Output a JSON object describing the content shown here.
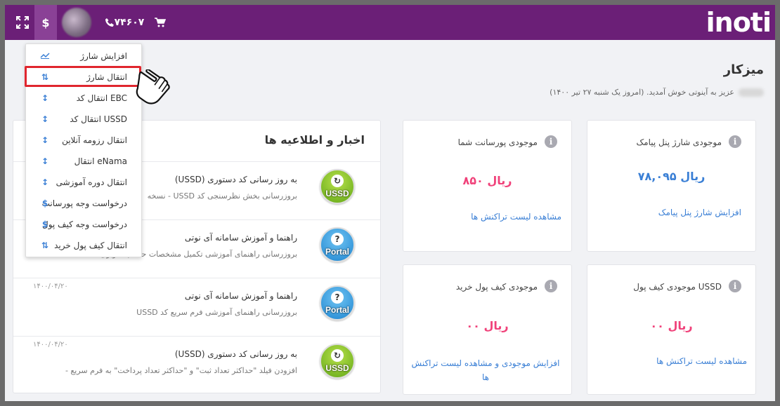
{
  "topbar": {
    "phone": "۷۴۶۰۷",
    "logo": "inoti",
    "expand_icon": "expand-icon",
    "currency_symbol": "$",
    "cart_icon": "cart-icon",
    "colors": {
      "bar": "#6b1f77",
      "active": "#8a4196"
    }
  },
  "page": {
    "title": "میزکار",
    "welcome": "عزیز به آینوتی خوش آمدید. (امروز یک شنبه ۲۷ تیر ۱۴۰۰)"
  },
  "menu": {
    "items": [
      {
        "label": "افزایش شارژ",
        "icon": "chart-line-icon"
      },
      {
        "label": "انتقال شارژ",
        "icon": "transfer-icon"
      },
      {
        "label": "EBC انتقال کد",
        "icon": "transfer-vertical-icon"
      },
      {
        "label": "USSD انتقال کد",
        "icon": "transfer-vertical-icon"
      },
      {
        "label": "انتقال رزومه آنلاین",
        "icon": "transfer-vertical-icon"
      },
      {
        "label": "eNama انتقال",
        "icon": "transfer-vertical-icon"
      },
      {
        "label": "انتقال دوره آموزشی",
        "icon": "transfer-vertical-icon"
      },
      {
        "label": "درخواست وجه پورسانت",
        "icon": "dollar-icon"
      },
      {
        "label": "درخواست وجه کیف پول",
        "icon": "dollar-icon"
      },
      {
        "label": "انتقال کیف پول خرید",
        "icon": "transfer-icon"
      }
    ],
    "highlighted_index": 1
  },
  "cards": {
    "sms_panel": {
      "title": "موجودی شارژ پنل پیامک",
      "value": "۷۸,۰۹۵ ریال",
      "link": "افزایش شارژ پنل پیامک"
    },
    "commission": {
      "title": "موجودی پورسانت شما",
      "value": "۸۵۰ ریال",
      "link": "مشاهده لیست تراکنش ها"
    },
    "ussd_wallet": {
      "title": "موجودی کیف پول USSD",
      "value": "۰۰ ریال",
      "link": "مشاهده لیست تراکنش ها"
    },
    "purchase_wallet": {
      "title": "موجودی کیف پول خرید",
      "value": "۰۰ ریال",
      "link": "افزایش موجودی و مشاهده لیست تراکنش ها"
    },
    "colors": {
      "value_blue": "#3a7fd5",
      "value_pink": "#f0427a"
    }
  },
  "news": {
    "title": "اخبار و اطلاعیه ها",
    "items": [
      {
        "icon_label": "USSD",
        "heading": "به روز رسانی کد دستوری (USSD)",
        "sub": "بروزرسانی بخش نظرسنجی کد USSD - نسخه",
        "date": ""
      },
      {
        "icon_label": "Portal",
        "heading": "راهنما و آموزش سامانه آی نوتی",
        "sub": "بروزرسانی راهنمای آموزشی تکمیل مشخصات حساب کاربری",
        "date": ""
      },
      {
        "icon_label": "Portal",
        "heading": "راهنما و آموزش سامانه آی نوتی",
        "sub": "بروزرسانی راهنمای آموزشی فرم سریع کد USSD",
        "date": "۱۴۰۰/۰۴/۲۰"
      },
      {
        "icon_label": "USSD",
        "heading": "به روز رسانی کد دستوری (USSD)",
        "sub": "افزودن فیلد \"حداکثر تعداد ثبت\" و \"حداکثر تعداد پرداخت\" به فرم سریع -",
        "date": "۱۴۰۰/۰۴/۲۰"
      }
    ]
  }
}
